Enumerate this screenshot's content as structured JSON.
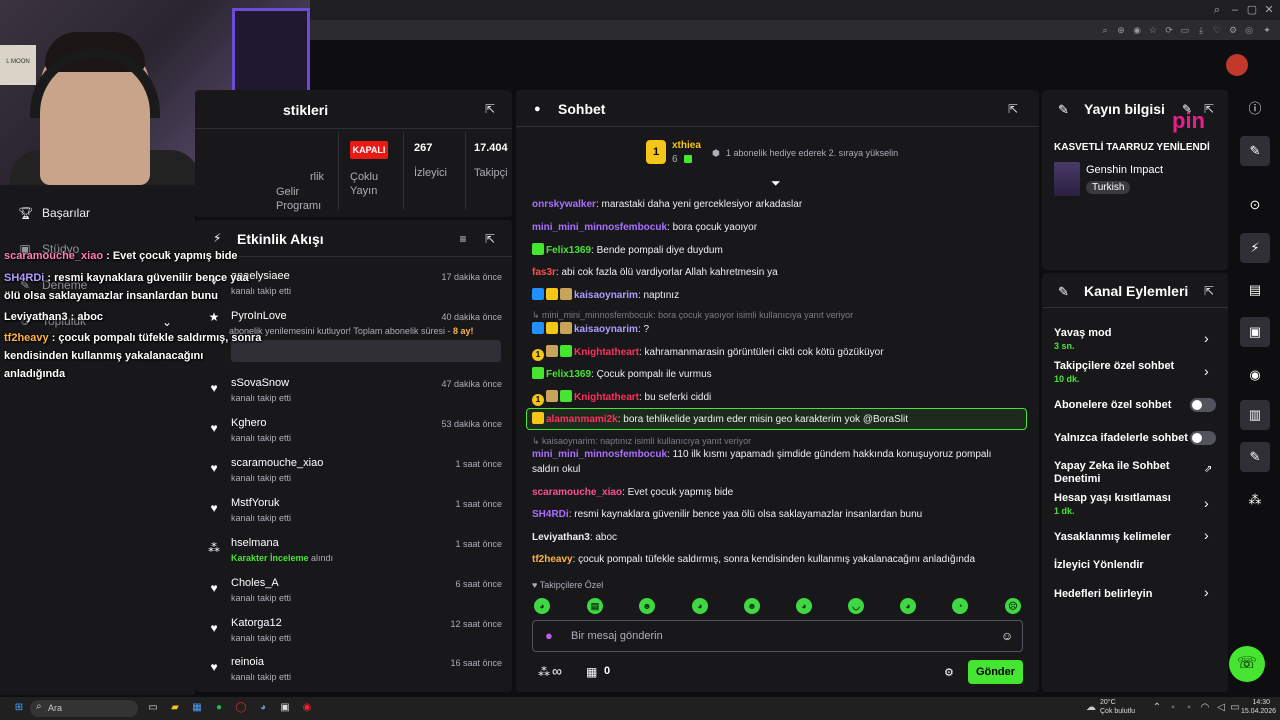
{
  "webcam": {
    "poster_text": "L MOON"
  },
  "leftnav": {
    "items": [
      {
        "label": "Başarılar",
        "icon": "trophy-icon"
      },
      {
        "label": "Stüdyo",
        "icon": "studio-icon"
      },
      {
        "label": "Deneme",
        "icon": "wrench-icon"
      },
      {
        "label": "Topluluk",
        "icon": "community-icon"
      }
    ]
  },
  "overlay": [
    {
      "user": "scaramouche_xiao",
      "color": "#ff7eb3",
      "text": " : Evet çocuk yapmış bide"
    },
    {
      "user": "SH4RDi",
      "color": "#b19cff",
      "text": " : resmi kaynaklara güvenilir bence yaa"
    },
    {
      "user": "",
      "color": "#ffffff",
      "text": "ölü olsa saklayamazlar insanlardan bunu"
    },
    {
      "user": "Leviyathan3",
      "color": "#ffffff",
      "text": " : aboc"
    },
    {
      "user": "tf2heavy",
      "color": "#ffb347",
      "text": " : çocuk pompalı tüfekle saldırmış, sonra"
    },
    {
      "user": "",
      "color": "#ffffff",
      "text": "kendisinden kullanmış yakalanacağını"
    },
    {
      "user": "",
      "color": "#ffffff",
      "text": "anladığında"
    }
  ],
  "stats": {
    "title": "stikleri",
    "items": [
      {
        "value": "",
        "label": "rlik"
      },
      {
        "value": "",
        "label": "Gelir Programı"
      },
      {
        "value": "KAPALI",
        "label": "Çoklu Yayın"
      },
      {
        "value": "267",
        "label": "İzleyici"
      },
      {
        "value": "17.404",
        "label": "Takipçi"
      }
    ]
  },
  "activity": {
    "title": "Etkinlik Akışı",
    "rows": [
      {
        "name": "anaelysiaee",
        "sub": "kanalı takip etti",
        "time": "17 dakika önce",
        "icon": "heart-icon"
      },
      {
        "name": "PyroInLove",
        "sub": "abonelik yenilemesini kutluyor! Toplam abonelik süresi - ",
        "sub_highlight": "8 ay!",
        "time": "40 dakika önce",
        "icon": "star-icon"
      },
      {
        "name": "sSovaSnow",
        "sub": "kanalı takip etti",
        "time": "47 dakika önce",
        "icon": "heart-icon"
      },
      {
        "name": "Kghero",
        "sub": "kanalı takip etti",
        "time": "53 dakika önce",
        "icon": "heart-icon"
      },
      {
        "name": "scaramouche_xiao",
        "sub": "kanalı takip etti",
        "time": "1 saat önce",
        "icon": "heart-icon"
      },
      {
        "name": "MstfYoruk",
        "sub": "kanalı takip etti",
        "time": "1 saat önce",
        "icon": "heart-icon"
      },
      {
        "name": "hselmana",
        "sub_green": "Karakter İnceleme",
        "sub": " alındı",
        "time": "1 saat önce",
        "icon": "points-icon"
      },
      {
        "name": "Choles_A",
        "sub": "kanalı takip etti",
        "time": "6 saat önce",
        "icon": "heart-icon"
      },
      {
        "name": "Katorga12",
        "sub": "kanalı takip etti",
        "time": "12 saat önce",
        "icon": "heart-icon"
      },
      {
        "name": "reinoia",
        "sub": "kanalı takip etti",
        "time": "16 saat önce",
        "icon": "heart-icon"
      }
    ]
  },
  "chat": {
    "title": "Sohbet",
    "gift": {
      "rank": "1",
      "user": "xthiea",
      "count": "6",
      "text": "1 abonelik hediye ederek 2. sıraya yükselin"
    },
    "messages": [
      {
        "user": "onrskywalker",
        "color": "#a970ff",
        "text": ": marastaki daha yeni gerceklesiyor arkadaslar",
        "badges": []
      },
      {
        "user": "mini_mini_minnosfembocuk",
        "color": "#a970ff",
        "text": ": bora çocuk yaoıyor",
        "badges": []
      },
      {
        "user": "Felix1369",
        "color": "#45e532",
        "text": ": Bende pompali diye duydum",
        "badges": [
          "sub"
        ]
      },
      {
        "user": "fas3r",
        "color": "#ff4f4f",
        "text": ": abi cok fazla ölü vardiyorlar Allah kahretmesin ya",
        "badges": []
      },
      {
        "user": "kaisaoynarim",
        "color": "#b19cff",
        "text": ": naptınız",
        "badges": [
          "prime",
          "crown",
          "gift"
        ]
      },
      {
        "reply": "mini_mini_minnosfembocuk: bora çocuk yaoıyor isimli kullanıcıya yanıt veriyor"
      },
      {
        "user": "kaisaoynarim",
        "color": "#b19cff",
        "text": ": ?",
        "badges": [
          "prime",
          "crown",
          "gift"
        ]
      },
      {
        "user": "Knightatheart",
        "color": "#ff2e5e",
        "text": ": kahramanmarasin görüntüleri cikti cok kötü gözüküyor",
        "badges": [
          "num",
          "gift",
          "sub"
        ]
      },
      {
        "user": "Felix1369",
        "color": "#45e532",
        "text": ": Çocuk pompalı ile vurmus",
        "badges": [
          "sub"
        ]
      },
      {
        "user": "Knightatheart",
        "color": "#ff2e5e",
        "text": ": bu seferki ciddi",
        "badges": [
          "num",
          "gift",
          "sub"
        ]
      },
      {
        "user": "alamanmami2k",
        "color": "#ff2e5e",
        "text": ": bora tehlikelide yardım eder misin geo karakterim yok @BoraSlit",
        "badges": [
          "crown"
        ],
        "highlight": true
      },
      {
        "reply": "kaisaoynarim: naptınız isimli kullanıcıya yanıt veriyor"
      },
      {
        "user": "mini_mini_minnosfembocuk",
        "color": "#a970ff",
        "text": ": 110 ilk kısmı yapamadı şimdide gündem hakkında konuşuyoruz pompalı",
        "badges": []
      },
      {
        "cont": "saldırı okul"
      },
      {
        "user": "scaramouche_xiao",
        "color": "#ff4f8f",
        "text": ": Evet çocuk yapmış bide",
        "badges": []
      },
      {
        "user": "SH4RDi",
        "color": "#a970ff",
        "text": ": resmi kaynaklara güvenilir bence yaa ölü olsa saklayamazlar insanlardan bunu",
        "badges": []
      },
      {
        "user": "Leviyathan3",
        "color": "#efeff1",
        "text": ": aboc",
        "badges": []
      },
      {
        "user": "tf2heavy",
        "color": "#ffb347",
        "text": ": çocuk pompalı tüfekle saldırmış, sonra kendisinden kullanmış yakalanacağını anladığında",
        "badges": []
      }
    ],
    "followers_only": "Takipçilere Özel",
    "input_placeholder": "Bir mesaj gönderin",
    "points": "∞",
    "store_count": "0",
    "send_label": "Gönder"
  },
  "streaminfo": {
    "title": "Yayın bilgisi",
    "stream_title": "KASVETLİ TAARRUZ YENİLENDİ",
    "game": "Genshin Impact",
    "language": "Turkish",
    "watermark": "pin"
  },
  "actions": {
    "title": "Kanal Eylemleri",
    "items": [
      {
        "label": "Yavaş mod",
        "sub": "3 sn.",
        "control": "chevron"
      },
      {
        "label": "Takipçilere özel sohbet",
        "sub": "10 dk.",
        "control": "chevron"
      },
      {
        "label": "Abonelere özel sohbet",
        "sub": "",
        "control": "toggle"
      },
      {
        "label": "Yalnızca ifadelerle sohbet",
        "sub": "",
        "control": "toggle"
      },
      {
        "label": "Yapay Zeka ile Sohbet Denetimi",
        "sub": "",
        "control": "external"
      },
      {
        "label": "Hesap yaşı kısıtlaması",
        "sub": "1 dk.",
        "control": "chevron"
      },
      {
        "label": "Yasaklanmış kelimeler",
        "sub": "",
        "control": "chevron"
      },
      {
        "label": "İzleyici Yönlendir",
        "sub": "",
        "control": "none"
      },
      {
        "label": "Hedefleri belirleyin",
        "sub": "",
        "control": "chevron"
      }
    ]
  },
  "taskbar": {
    "search_placeholder": "Ara",
    "weather_temp": "20°C",
    "weather_text": "Çok bulutlu",
    "time": "14:30",
    "date": "15.04.2026"
  },
  "colors": {
    "accent": "#45e532",
    "background": "#0e0e10",
    "panel": "#18181b",
    "live": "#e91916"
  }
}
